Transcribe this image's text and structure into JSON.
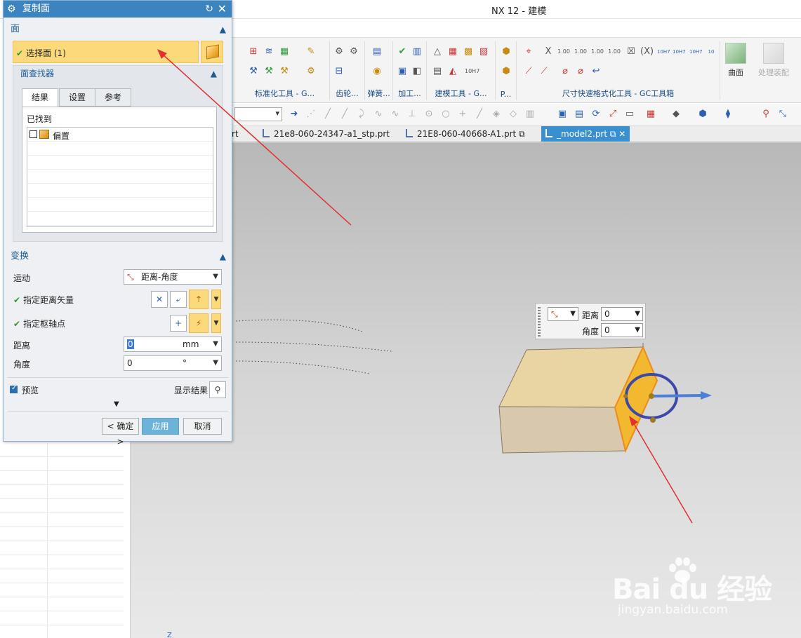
{
  "window": {
    "title": "NX 12 - 建模"
  },
  "dialog": {
    "title": "复制面",
    "face_section": {
      "header": "面",
      "select_face_label": "选择面 (1)",
      "face_finder_header": "面查找器",
      "tabs": [
        "结果",
        "设置",
        "参考"
      ],
      "found_label": "已找到",
      "found_items": [
        {
          "label": "偏置",
          "checked": false
        }
      ]
    },
    "transform_section": {
      "header": "变换",
      "motion_label": "运动",
      "motion_value": "距离-角度",
      "distance_vector_label": "指定距离矢量",
      "pivot_point_label": "指定枢轴点",
      "distance_label": "距离",
      "distance_value": "0",
      "distance_unit": "mm",
      "angle_label": "角度",
      "angle_value": "0",
      "angle_unit": "°"
    },
    "preview_label": "预览",
    "preview_checked": true,
    "show_result_label": "显示结果",
    "ok_label": "< 确定 >",
    "apply_label": "应用",
    "cancel_label": "取消"
  },
  "ribbon": {
    "group_labels": [
      "标准化工具 - G...",
      "齿轮...",
      "弹簧...",
      "加工...",
      "建模工具 - G...",
      "P...",
      "尺寸快速格式化工具 - GC工具箱"
    ],
    "surface_label": "曲面",
    "assembly_label": "处理装配"
  },
  "doc_tabs": [
    {
      "label": "rt",
      "active": false
    },
    {
      "label": "21e8-060-24347-a1_stp.prt",
      "active": false
    },
    {
      "label": "21E8-060-40668-A1.prt",
      "active": false
    },
    {
      "label": "_model2.prt",
      "active": true
    }
  ],
  "graphic_popup": {
    "distance_label": "距离",
    "distance_value": "0",
    "angle_label": "角度",
    "angle_value": "0"
  },
  "watermark": {
    "logo_text": "Bai du 经验",
    "url_text": "jingyan.baidu.com"
  },
  "colors": {
    "dialog_title": "#3c84bf",
    "highlight": "#fcd97a",
    "accent_link": "#1d5d96",
    "annotation_arrow": "#e03030"
  }
}
